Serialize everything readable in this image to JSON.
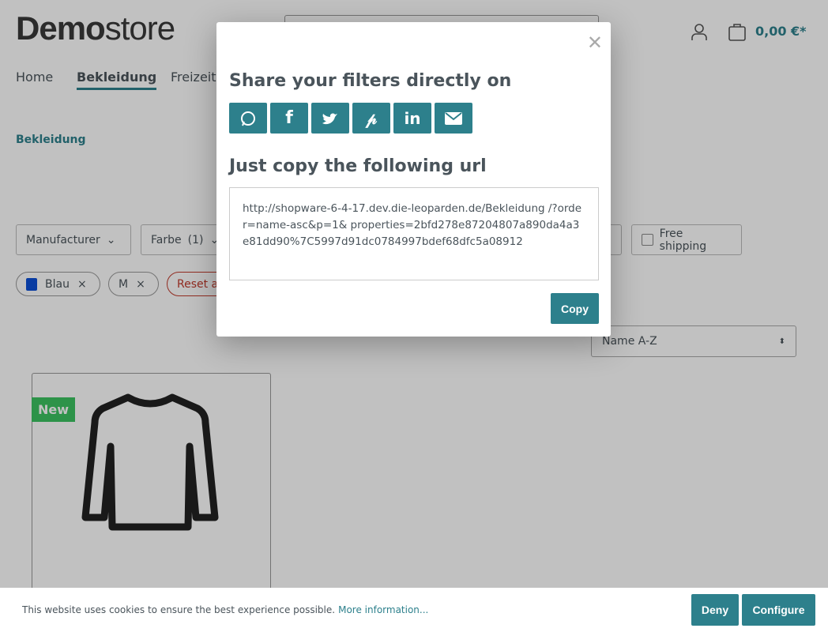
{
  "header": {
    "logo_bold": "Demo",
    "logo_light": "store",
    "cart_total": "0,00 €*"
  },
  "nav": [
    {
      "label": "Home"
    },
    {
      "label": "Bekleidung"
    },
    {
      "label": "Freizeit"
    }
  ],
  "breadcrumb": "Bekleidung",
  "filters": [
    {
      "label": "Manufacturer"
    },
    {
      "label": "Farbe",
      "count": "(1)"
    },
    {
      "label": "Free shipping"
    }
  ],
  "active_filters": [
    {
      "label": "Blau",
      "color": "#0b4fd6"
    },
    {
      "label": "M"
    }
  ],
  "reset_label": "Reset a",
  "sort": {
    "selected": "Name A-Z"
  },
  "product": {
    "badge": "New"
  },
  "modal": {
    "title_share": "Share your filters directly on",
    "share_icons": [
      "whatsapp-icon",
      "facebook-icon",
      "twitter-icon",
      "pinterest-icon",
      "linkedin-icon",
      "email-icon"
    ],
    "title_copy": "Just copy the following url",
    "url": "http://shopware-6-4-17.dev.die-leoparden.de/Bekleidung /?order=name-asc&p=1& properties=2bfd278e87204807a890da4a3e81dd90%7C5997d91dc0784997bdef68dfc5a08912",
    "copy_label": "Copy"
  },
  "cookie": {
    "text": "This website uses cookies to ensure the best experience possible.",
    "link": "More information...",
    "deny": "Deny",
    "configure": "Configure"
  },
  "colors": {
    "primary": "#2d808c",
    "new_badge": "#3cc261"
  }
}
